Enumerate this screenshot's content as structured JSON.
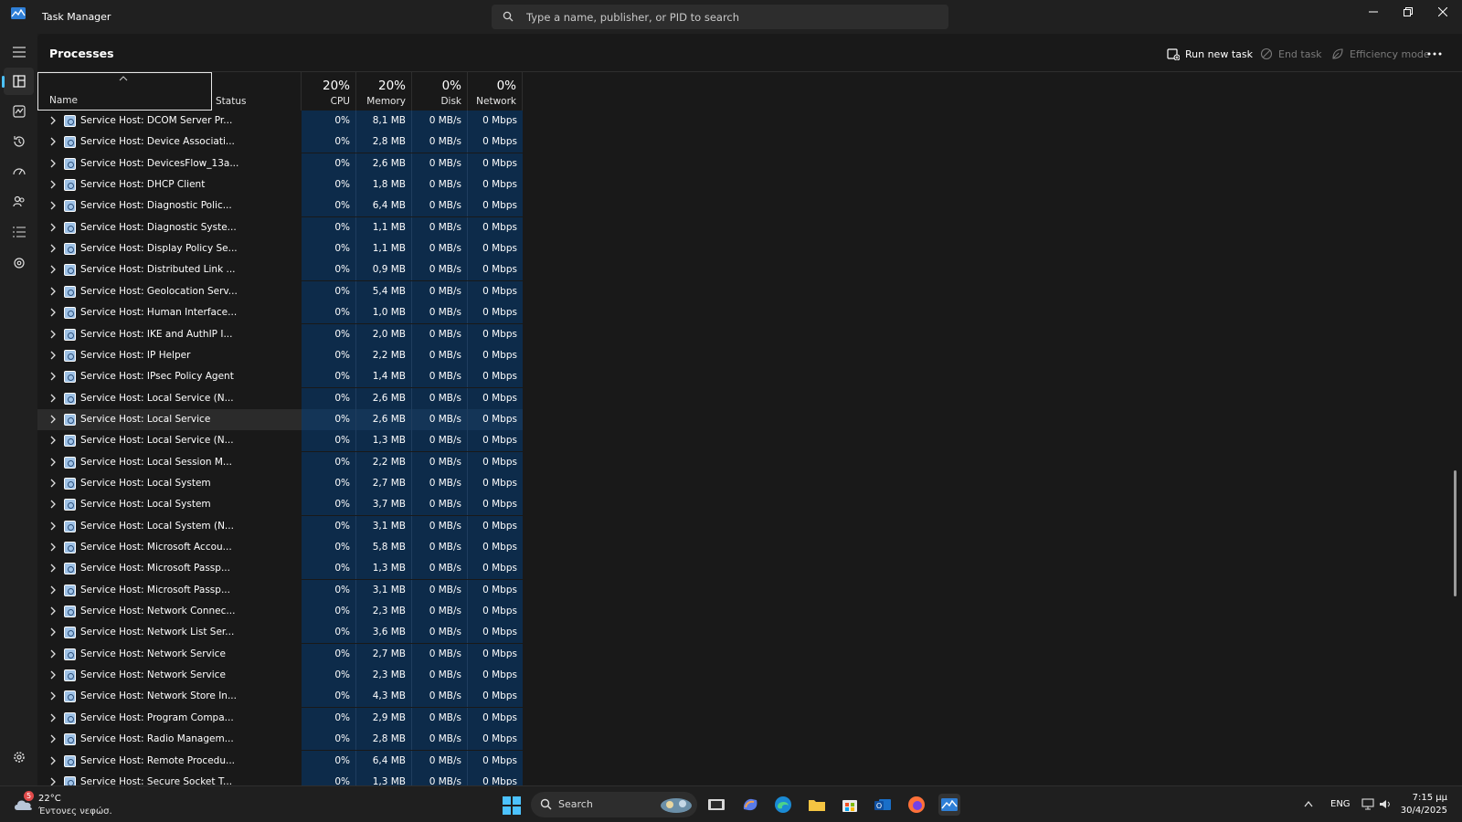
{
  "window": {
    "title": "Task Manager"
  },
  "search": {
    "placeholder": "Type a name, publisher, or PID to search"
  },
  "page": {
    "title": "Processes"
  },
  "toolbar": {
    "run_new_task": "Run new task",
    "end_task": "End task",
    "efficiency_mode": "Efficiency mode",
    "more": "..."
  },
  "columns": {
    "name": "Name",
    "status": "Status",
    "cpu": {
      "label": "CPU",
      "pct": "20%"
    },
    "memory": {
      "label": "Memory",
      "pct": "20%"
    },
    "disk": {
      "label": "Disk",
      "pct": "0%"
    },
    "network": {
      "label": "Network",
      "pct": "0%"
    }
  },
  "processes": [
    {
      "name": "Service Host: DCOM Server Pr...",
      "cpu": "0%",
      "memory": "8,1 MB",
      "disk": "0 MB/s",
      "network": "0 Mbps"
    },
    {
      "name": "Service Host: Device Associati...",
      "cpu": "0%",
      "memory": "2,8 MB",
      "disk": "0 MB/s",
      "network": "0 Mbps"
    },
    {
      "name": "Service Host: DevicesFlow_13a...",
      "cpu": "0%",
      "memory": "2,6 MB",
      "disk": "0 MB/s",
      "network": "0 Mbps"
    },
    {
      "name": "Service Host: DHCP Client",
      "cpu": "0%",
      "memory": "1,8 MB",
      "disk": "0 MB/s",
      "network": "0 Mbps"
    },
    {
      "name": "Service Host: Diagnostic Polic...",
      "cpu": "0%",
      "memory": "6,4 MB",
      "disk": "0 MB/s",
      "network": "0 Mbps"
    },
    {
      "name": "Service Host: Diagnostic Syste...",
      "cpu": "0%",
      "memory": "1,1 MB",
      "disk": "0 MB/s",
      "network": "0 Mbps"
    },
    {
      "name": "Service Host: Display Policy Se...",
      "cpu": "0%",
      "memory": "1,1 MB",
      "disk": "0 MB/s",
      "network": "0 Mbps"
    },
    {
      "name": "Service Host: Distributed Link ...",
      "cpu": "0%",
      "memory": "0,9 MB",
      "disk": "0 MB/s",
      "network": "0 Mbps"
    },
    {
      "name": "Service Host: Geolocation Serv...",
      "cpu": "0%",
      "memory": "5,4 MB",
      "disk": "0 MB/s",
      "network": "0 Mbps"
    },
    {
      "name": "Service Host: Human Interface...",
      "cpu": "0%",
      "memory": "1,0 MB",
      "disk": "0 MB/s",
      "network": "0 Mbps"
    },
    {
      "name": "Service Host: IKE and AuthIP I...",
      "cpu": "0%",
      "memory": "2,0 MB",
      "disk": "0 MB/s",
      "network": "0 Mbps"
    },
    {
      "name": "Service Host: IP Helper",
      "cpu": "0%",
      "memory": "2,2 MB",
      "disk": "0 MB/s",
      "network": "0 Mbps"
    },
    {
      "name": "Service Host: IPsec Policy Agent",
      "cpu": "0%",
      "memory": "1,4 MB",
      "disk": "0 MB/s",
      "network": "0 Mbps"
    },
    {
      "name": "Service Host: Local Service (N...",
      "cpu": "0%",
      "memory": "2,6 MB",
      "disk": "0 MB/s",
      "network": "0 Mbps"
    },
    {
      "name": "Service Host: Local Service (N...",
      "cpu": "0%",
      "memory": "2,6 MB",
      "disk": "0 MB/s",
      "network": "0 Mbps"
    },
    {
      "name": "Service Host: Local Service (N...",
      "cpu": "0%",
      "memory": "1,3 MB",
      "disk": "0 MB/s",
      "network": "0 Mbps"
    },
    {
      "name": "Service Host: Local Session M...",
      "cpu": "0%",
      "memory": "2,2 MB",
      "disk": "0 MB/s",
      "network": "0 Mbps"
    },
    {
      "name": "Service Host: Local System",
      "cpu": "0%",
      "memory": "2,7 MB",
      "disk": "0 MB/s",
      "network": "0 Mbps"
    },
    {
      "name": "Service Host: Local System",
      "cpu": "0%",
      "memory": "3,7 MB",
      "disk": "0 MB/s",
      "network": "0 Mbps"
    },
    {
      "name": "Service Host: Local System (N...",
      "cpu": "0%",
      "memory": "3,1 MB",
      "disk": "0 MB/s",
      "network": "0 Mbps"
    },
    {
      "name": "Service Host: Microsoft Accou...",
      "cpu": "0%",
      "memory": "5,8 MB",
      "disk": "0 MB/s",
      "network": "0 Mbps"
    },
    {
      "name": "Service Host: Microsoft Passp...",
      "cpu": "0%",
      "memory": "1,3 MB",
      "disk": "0 MB/s",
      "network": "0 Mbps"
    },
    {
      "name": "Service Host: Microsoft Passp...",
      "cpu": "0%",
      "memory": "3,1 MB",
      "disk": "0 MB/s",
      "network": "0 Mbps"
    },
    {
      "name": "Service Host: Network Connec...",
      "cpu": "0%",
      "memory": "2,3 MB",
      "disk": "0 MB/s",
      "network": "0 Mbps"
    },
    {
      "name": "Service Host: Network List Ser...",
      "cpu": "0%",
      "memory": "3,6 MB",
      "disk": "0 MB/s",
      "network": "0 Mbps"
    },
    {
      "name": "Service Host: Network Service",
      "cpu": "0%",
      "memory": "2,7 MB",
      "disk": "0 MB/s",
      "network": "0 Mbps"
    },
    {
      "name": "Service Host: Network Service",
      "cpu": "0%",
      "memory": "2,3 MB",
      "disk": "0 MB/s",
      "network": "0 Mbps"
    },
    {
      "name": "Service Host: Network Store In...",
      "cpu": "0%",
      "memory": "4,3 MB",
      "disk": "0 MB/s",
      "network": "0 Mbps"
    },
    {
      "name": "Service Host: Program Compa...",
      "cpu": "0%",
      "memory": "2,9 MB",
      "disk": "0 MB/s",
      "network": "0 Mbps"
    },
    {
      "name": "Service Host: Radio Managem...",
      "cpu": "0%",
      "memory": "2,8 MB",
      "disk": "0 MB/s",
      "network": "0 Mbps"
    },
    {
      "name": "Service Host: Remote Procedu...",
      "cpu": "0%",
      "memory": "6,4 MB",
      "disk": "0 MB/s",
      "network": "0 Mbps"
    },
    {
      "name": "Service Host: Secure Socket T...",
      "cpu": "0%",
      "memory": "1,3 MB",
      "disk": "0 MB/s",
      "network": "0 Mbps"
    }
  ],
  "highlighted_row": 14,
  "taskbar": {
    "weather_temp": "22°C",
    "weather_desc": "Έντονες νεφώσ.",
    "weather_badge": "5",
    "search_label": "Search",
    "language": "ENG",
    "time": "7:15 μμ",
    "date": "30/4/2025"
  },
  "colors": {
    "accent": "#4cc2ff",
    "metric_cell": "#0d2b4a",
    "background": "#191919"
  }
}
